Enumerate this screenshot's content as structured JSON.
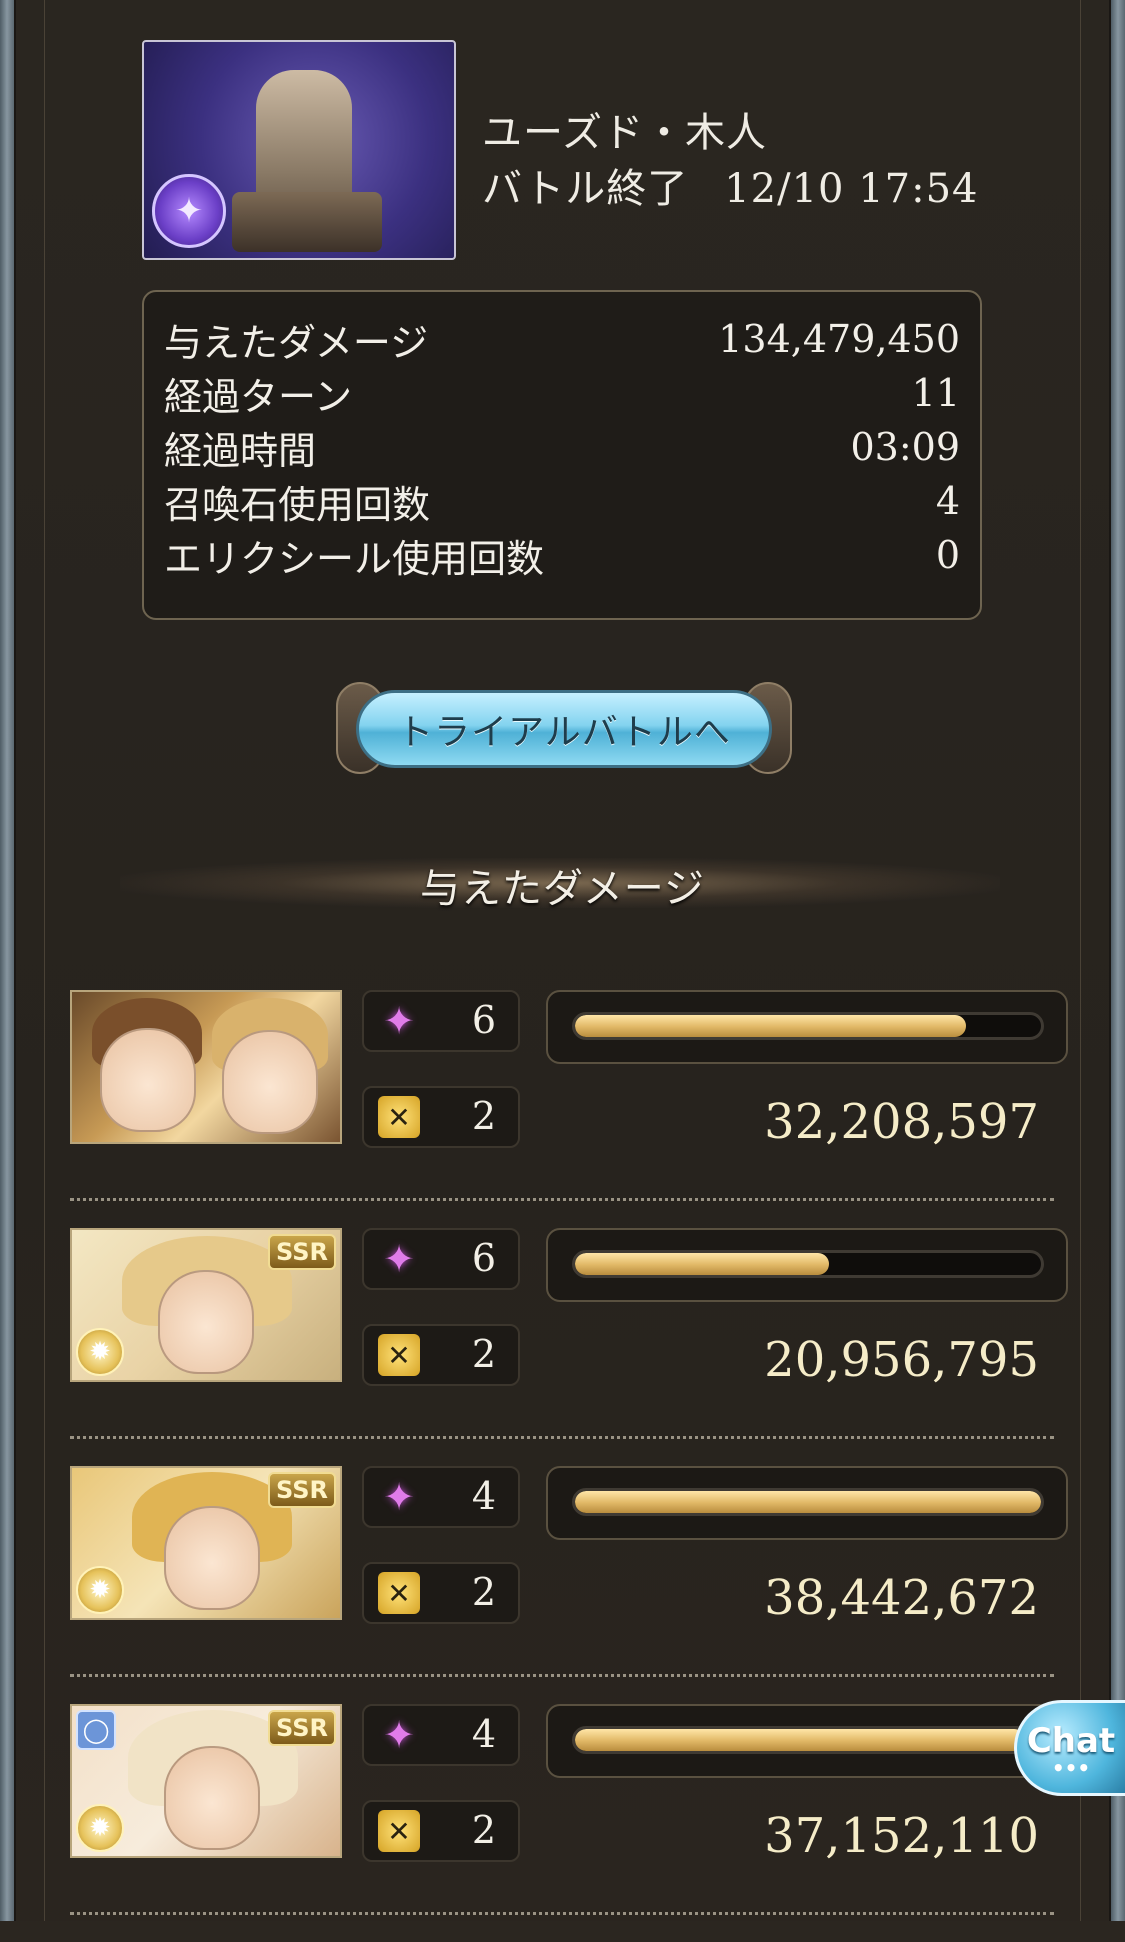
{
  "header": {
    "boss_name": "ユーズド・木人",
    "battle_status": "バトル終了",
    "timestamp": "12/10 17:54"
  },
  "stats": [
    {
      "label": "与えたダメージ",
      "value": "134,479,450"
    },
    {
      "label": "経過ターン",
      "value": "11"
    },
    {
      "label": "経過時間",
      "value": "03:09"
    },
    {
      "label": "召喚石使用回数",
      "value": "4"
    },
    {
      "label": "エリクシール使用回数",
      "value": "0"
    }
  ],
  "trial_button": {
    "label": "トライアルバトルへ"
  },
  "section_title": "与えたダメージ",
  "characters": [
    {
      "portrait_icon": "character-portrait-duo",
      "rarity": "",
      "skill_count": "6",
      "chain_count": "2",
      "damage": "32,208,597",
      "bar_fraction": 0.838
    },
    {
      "portrait_icon": "character-portrait",
      "rarity": "SSR",
      "skill_count": "6",
      "chain_count": "2",
      "damage": "20,956,795",
      "bar_fraction": 0.545
    },
    {
      "portrait_icon": "character-portrait",
      "rarity": "SSR",
      "skill_count": "4",
      "chain_count": "2",
      "damage": "38,442,672",
      "bar_fraction": 1.0
    },
    {
      "portrait_icon": "character-portrait",
      "rarity": "SSR",
      "skill_count": "4",
      "chain_count": "2",
      "damage": "37,152,110",
      "bar_fraction": 0.966
    }
  ],
  "icons": {
    "skill": "sparkle-star-icon",
    "chain": "chain-burst-icon",
    "element": "dark-element-icon",
    "light_element": "light-element-icon"
  },
  "chat": {
    "label": "Chat"
  },
  "colors": {
    "bar_fill": "#e0b765",
    "trial_button": "#83d3ef",
    "skill_icon": "#e07ce9",
    "chain_icon": "#d5a325"
  }
}
